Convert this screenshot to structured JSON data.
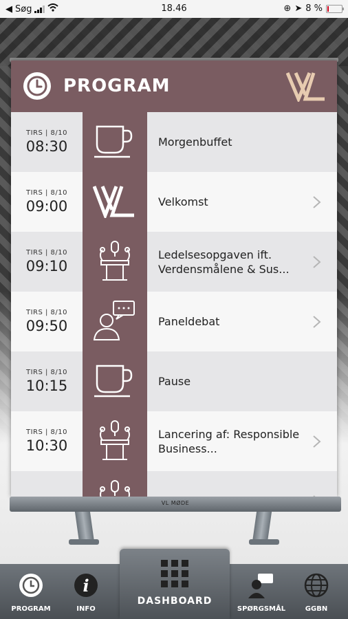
{
  "status_bar": {
    "carrier": "Søg",
    "time": "18.46",
    "battery": "8 %"
  },
  "header": {
    "title": "PROGRAM"
  },
  "schedule": [
    {
      "day": "TIRS | 8/10",
      "time": "08:30",
      "title": "Morgenbuffet",
      "icon": "coffee-cup-icon",
      "chevron": false
    },
    {
      "day": "TIRS | 8/10",
      "time": "09:00",
      "title": "Velkomst",
      "icon": "vl-logo-icon",
      "chevron": true
    },
    {
      "day": "TIRS | 8/10",
      "time": "09:10",
      "title": "Ledelsesopgaven ift. Verdensmålene & Sus...",
      "icon": "speaker-podium-icon",
      "chevron": true
    },
    {
      "day": "TIRS | 8/10",
      "time": "09:50",
      "title": "Paneldebat",
      "icon": "speech-bubble-person-icon",
      "chevron": true
    },
    {
      "day": "TIRS | 8/10",
      "time": "10:15",
      "title": "Pause",
      "icon": "coffee-cup-icon",
      "chevron": false
    },
    {
      "day": "TIRS | 8/10",
      "time": "10:30",
      "title": "Lancering af: Responsible Business...",
      "icon": "speaker-podium-icon",
      "chevron": true
    },
    {
      "day": "TIRS | 8/10",
      "time": "",
      "title": "",
      "icon": "speaker-podium-icon",
      "chevron": true
    }
  ],
  "banner_base_label": "VL MØDE",
  "tabs": {
    "program": "PROGRAM",
    "info": "INFO",
    "dashboard": "DASHBOARD",
    "questions": "SPØRGSMÅL",
    "ggbn": "GGBN"
  },
  "colors": {
    "accent": "#7a5c61",
    "row_alt": "#e6e6e8",
    "row_norm": "#f7f7f7"
  }
}
